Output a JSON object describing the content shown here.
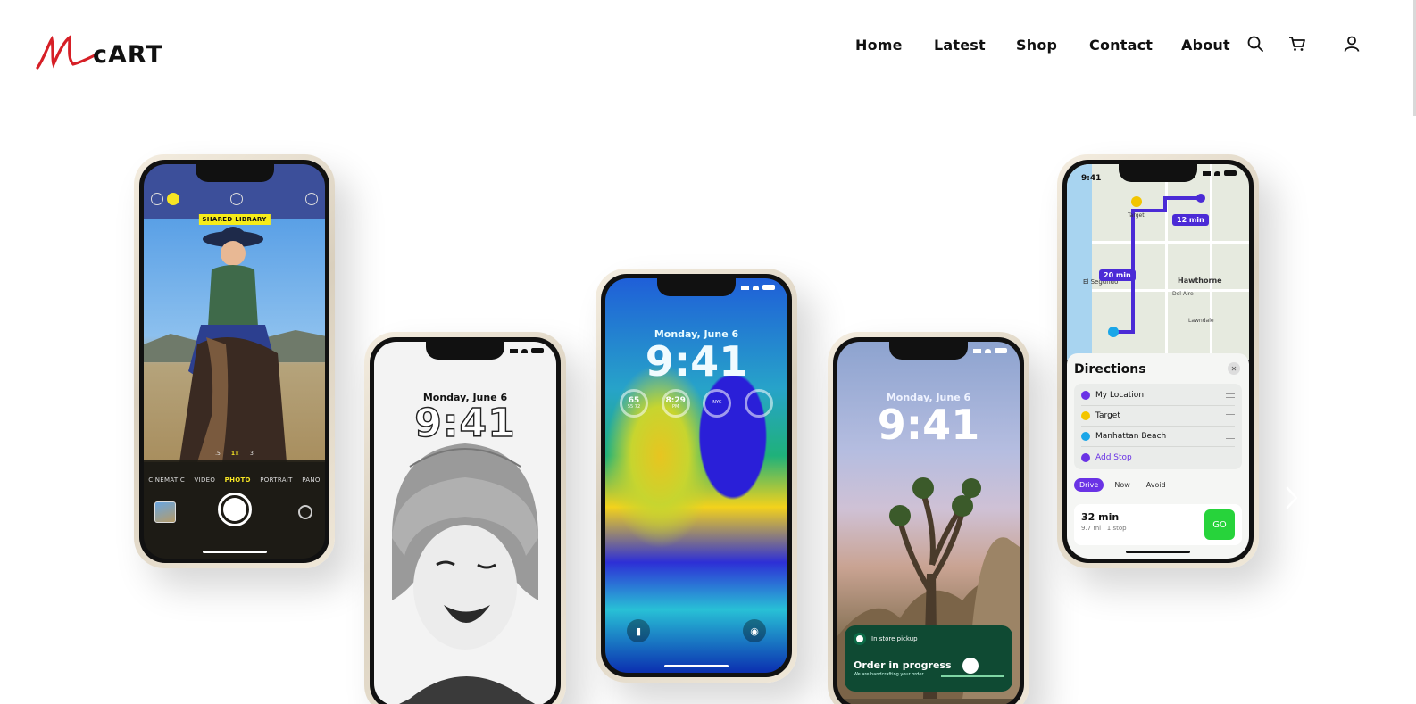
{
  "brand": {
    "logo_script": "M",
    "logo_text": "cART",
    "logo_color": "#d61f26"
  },
  "nav": {
    "items": [
      {
        "label": "Home"
      },
      {
        "label": "Latest"
      },
      {
        "label": "Shop"
      },
      {
        "label": "Contact"
      },
      {
        "label": "About"
      }
    ],
    "icons": [
      "search-icon",
      "cart-icon",
      "user-icon"
    ]
  },
  "hero": {
    "phones": [
      {
        "name": "camera",
        "badge": "SHARED LIBRARY",
        "zoom": [
          ".5",
          "1×",
          "3"
        ],
        "modes": [
          "CINEMATIC",
          "VIDEO",
          "PHOTO",
          "PORTRAIT",
          "PANO"
        ],
        "selected_mode": "PHOTO"
      },
      {
        "name": "portrait",
        "date": "Monday, June 6",
        "time": "9:41"
      },
      {
        "name": "center",
        "date": "Monday, June 6",
        "time": "9:41",
        "widgets": [
          {
            "value": "65",
            "sub": "55  72"
          },
          {
            "value": "8:29",
            "sub": "PM"
          },
          {
            "value": "",
            "sub": "NYC"
          },
          {
            "value": "",
            "sub": ""
          }
        ]
      },
      {
        "name": "tree",
        "date": "Monday, June 6",
        "time": "9:41",
        "live_activity": {
          "label": "In store pickup",
          "title": "Order in progress",
          "subtitle": "We are handcrafting your order"
        }
      },
      {
        "name": "maps",
        "status_time": "9:41",
        "map_labels": [
          "12 min",
          "20 min",
          "Hawthorne",
          "El Segundo",
          "Del Aire",
          "Lawndale",
          "Target"
        ],
        "sheet_title": "Directions",
        "stops": [
          {
            "label": "My Location",
            "color": "#6a33e5"
          },
          {
            "label": "Target",
            "color": "#f2c500"
          },
          {
            "label": "Manhattan Beach",
            "color": "#1aa6e8"
          },
          {
            "label": "Add Stop",
            "color": "#6a33e5"
          }
        ],
        "options": [
          "Drive",
          "Now",
          "Avoid"
        ],
        "route_time": "32 min",
        "route_detail": "9.7 mi · 1 stop",
        "go_label": "GO"
      }
    ]
  }
}
